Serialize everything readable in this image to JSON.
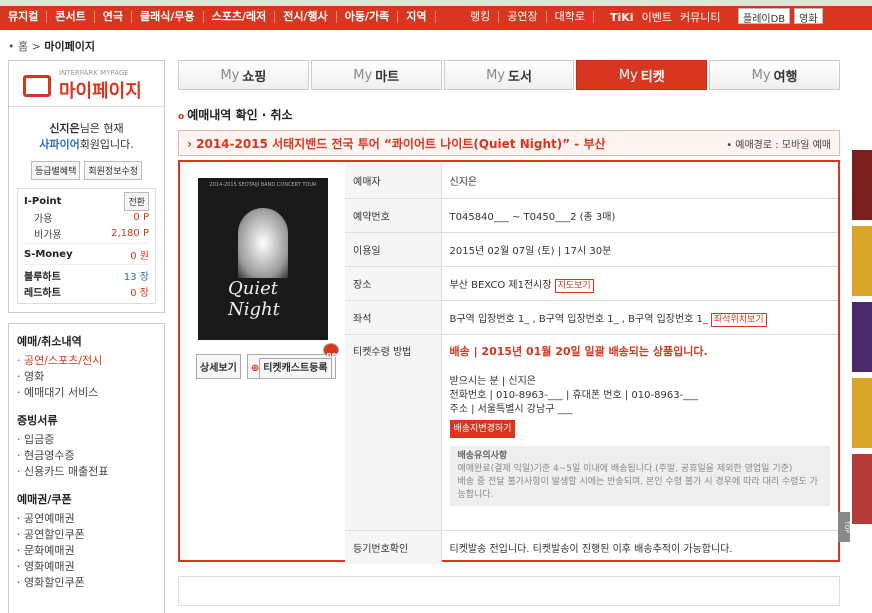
{
  "topbar": {
    "menu": [
      "뮤지컬",
      "콘서트",
      "연극",
      "클래식/무용",
      "스포츠/레저",
      "전시/행사",
      "아동/가족",
      "지역"
    ],
    "menu2": [
      "랭킹",
      "공연장",
      "대학로"
    ],
    "tiki": "TiKi",
    "tiki_links": [
      "이벤트",
      "커뮤니티"
    ],
    "play_db": "플레이DB",
    "movie": "영화"
  },
  "breadcrumb": {
    "home": "홈",
    "sep": ">",
    "current": "마이페이지"
  },
  "sidebar": {
    "logo_small": "INTERPARK MYPAGE",
    "logo_big": "마이페이지",
    "user_name": "신지은",
    "user_line1_suffix": "님은 현재",
    "grade": "사파이어",
    "user_line2_suffix": "회원입니다.",
    "btn_benefit": "등급별혜택",
    "btn_edit": "회원정보수정",
    "points": {
      "ipoint_label": "I-Point",
      "ipoint_btn": "전환",
      "avail_label": "가용",
      "avail_value": "0 P",
      "unavail_label": "비가용",
      "unavail_value": "2,180 P",
      "smoney_label": "S-Money",
      "smoney_value": "0 원",
      "blue_label": "블루하트",
      "blue_value": "13 장",
      "red_label": "레드하트",
      "red_value": "0 장"
    },
    "groups": [
      {
        "title": "예매/취소내역",
        "items": [
          "공연/스포츠/전시",
          "영화",
          "예매대기 서비스"
        ]
      },
      {
        "title": "증빙서류",
        "items": [
          "입금증",
          "현금영수증",
          "신용카드 매출전표"
        ]
      },
      {
        "title": "예매권/쿠폰",
        "items": [
          "공연예매권",
          "공연할인쿠폰",
          "문화예매권",
          "영화예매권",
          "영화할인쿠폰"
        ]
      }
    ]
  },
  "tabs": [
    {
      "prefix": "My",
      "label": "쇼핑"
    },
    {
      "prefix": "My",
      "label": "마트"
    },
    {
      "prefix": "My",
      "label": "도서"
    },
    {
      "prefix": "My",
      "label": "티켓"
    },
    {
      "prefix": "My",
      "label": "여행"
    }
  ],
  "section_title": "예매내역 확인 · 취소",
  "performance": {
    "title": "› 2014-2015 서태지밴드 전국 투어 “콰이어트 나이트(Quiet Night)” - 부산",
    "route": "• 예매경로 : 모바일 예매"
  },
  "poster": {
    "header": "2014-2015 SEOTAIJI BAND CONCERT TOUR",
    "title": "Quiet Night"
  },
  "poster_buttons": {
    "detail": "상세보기",
    "ticast": "티켓캐스트등록",
    "new": "new"
  },
  "details": {
    "booker_label": "예매자",
    "booker": "신지은",
    "booking_label": "예약번호",
    "booking": "T045840___ ~ T0450___2 (총 3매)",
    "date_label": "이용일",
    "date": "2015년 02월 07일 (토) | 17시 30분",
    "venue_label": "장소",
    "venue": "부산 BEXCO 제1전시장",
    "map_btn": "지도보기",
    "seat_label": "좌석",
    "seat": "B구역 입장번호 1_ , B구역 입장번호 1_ , B구역 입장번호 1_",
    "seat_btn": "좌석위치보기",
    "receive_label": "티켓수령 방법",
    "ship_title": "배송 | 2015년 01월 20일 일괄 배송되는 상품입니다.",
    "recipient": "받으시는 분 | 신지은",
    "phone": "전화번호 | 010-8963-___ | 휴대폰 번호 | 010-8963-___",
    "address": "주소 | 서울특별시 강남구 ___",
    "addr_btn": "배송지변경하기",
    "notice_title": "배송유의사항",
    "notice1": "예매완료(결제 익일)기준 4~5일 이내에 배송됩니다.(주말, 공휴일을 제외한 영업일 기준)",
    "notice2": "배송 중 전달 불가사항이 발생할 시에는 반송되며, 본인 수령 불가 시 경우에 따라 대리 수령도 가능합니다.",
    "reg_label": "등기번호확인",
    "reg": "티켓발송 전입니다. 티켓발송이 진행된 이후 배송추적이 가능합니다."
  },
  "top_btn": "TOP"
}
